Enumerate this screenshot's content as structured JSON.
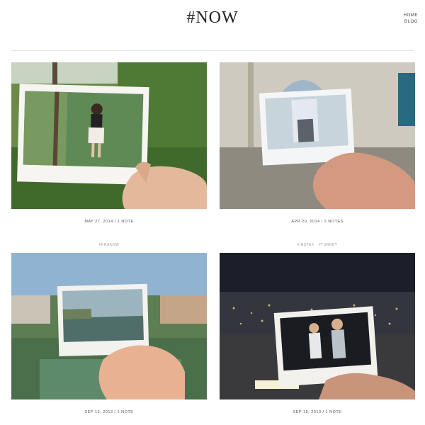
{
  "site": {
    "title": "#NOW"
  },
  "nav": [
    {
      "label": "HOME"
    },
    {
      "label": "BLOG"
    }
  ],
  "posts": [
    {
      "meta": "MAY 27, 2014 / 1 NOTE",
      "tags": [
        "#KRAKOW"
      ]
    },
    {
      "meta": "APR 20, 2014 / 2 NOTES",
      "tags": [
        "#INSTAX",
        "#TURKEY"
      ]
    },
    {
      "meta": "SEP 15, 2013 / 1 NOTE",
      "tags": []
    },
    {
      "meta": "SEP 15, 2013 / 1 NOTE",
      "tags": []
    }
  ],
  "colors": {
    "accent": "#222222",
    "rule": "#e4e4e4",
    "meta_text": "#555555",
    "tag_text": "#999999"
  }
}
